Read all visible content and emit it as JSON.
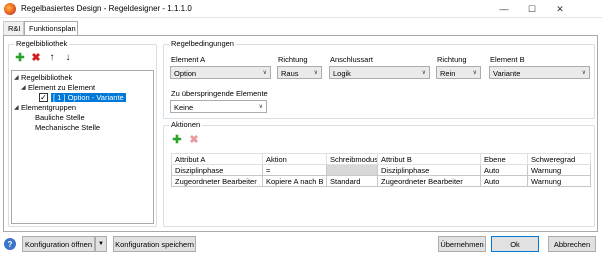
{
  "window": {
    "title": "Regelbasiertes Design - Regeldesigner - 1.1.1.0",
    "minimize": "—",
    "maximize": "☐",
    "close": "✕"
  },
  "tabs": [
    {
      "label": "R&I"
    },
    {
      "label": "Funktionsplan"
    }
  ],
  "library": {
    "group_title": "Regelbibliothek",
    "tree": {
      "root": "Regelbibliothek",
      "node_element_zu_element": "Element zu Element",
      "node_rule": "[ 1 ]  Option - Variante",
      "node_elementgruppen": "Elementgruppen",
      "leaf_bauliche": "Bauliche Stelle",
      "leaf_mechanische": "Mechanische Stelle"
    },
    "expander_open": "◢",
    "checkmark": "✓"
  },
  "conditions": {
    "group_title": "Regelbedingungen",
    "element_a_label": "Element A",
    "element_a_value": "Option",
    "richtung1_label": "Richtung",
    "richtung1_value": "Raus",
    "anschlussart_label": "Anschlussart",
    "anschlussart_value": "Logik",
    "richtung2_label": "Richtung",
    "richtung2_value": "Rein",
    "element_b_label": "Element B",
    "element_b_value": "Variante",
    "skip_label": "Zu überspringende Elemente",
    "skip_value": "Keine",
    "chevron": "∨"
  },
  "actions": {
    "group_title": "Aktionen",
    "columns": [
      "Attribut A",
      "Aktion",
      "Schreibmodus",
      "Attribut B",
      "Ebene",
      "Schweregrad"
    ],
    "rows": [
      [
        "Disziplinphase",
        "=",
        "",
        "Disziplinphase",
        "Auto",
        "Warnung"
      ],
      [
        "Zugeordneter Bearbeiter",
        "Kopiere A nach B",
        "Standard",
        "Zugeordneter Bearbeiter",
        "Auto",
        "Warnung"
      ]
    ]
  },
  "toolbar": {
    "add": "✚",
    "remove": "✖",
    "up": "↑",
    "down": "↓"
  },
  "footer": {
    "help": "?",
    "open_config": "Konfiguration öffnen",
    "open_dropdown": "▼",
    "save_config": "Konfiguration speichern",
    "apply": "Übernehmen",
    "ok": "Ok",
    "cancel": "Abbrechen"
  }
}
